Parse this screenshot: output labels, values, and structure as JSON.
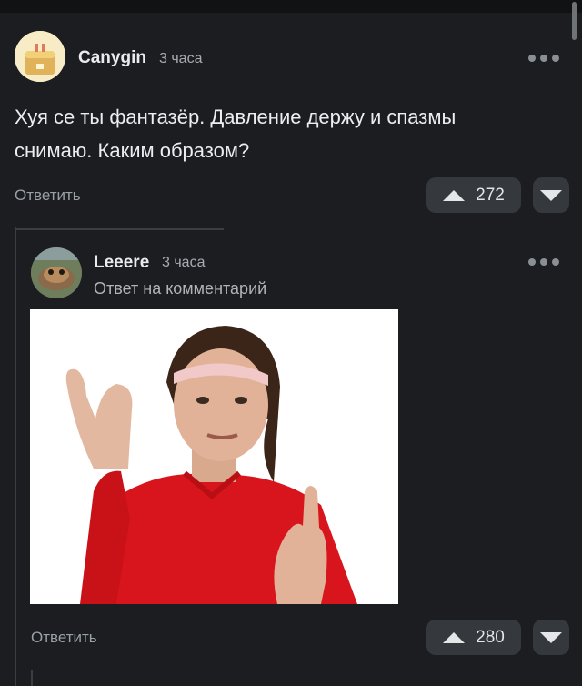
{
  "comments": [
    {
      "username": "Canygin",
      "time": "3 часа",
      "text": "Хуя се ты фантазёр. Давление держу и спазмы\nснимаю. Каким образом?",
      "reply_label": "Ответить",
      "votes": "272"
    },
    {
      "username": "Leeere",
      "time": "3 часа",
      "caption": "Ответ на комментарий",
      "reply_label": "Ответить",
      "votes": "280"
    }
  ],
  "icons": {
    "more": "more-dots-icon",
    "upvote": "triangle-up-icon",
    "downvote": "triangle-down-icon"
  },
  "colors": {
    "background": "#1b1d21",
    "vote_bg": "#35383c",
    "muted_text": "#9aa0a4",
    "shirt_red": "#d8151c"
  }
}
